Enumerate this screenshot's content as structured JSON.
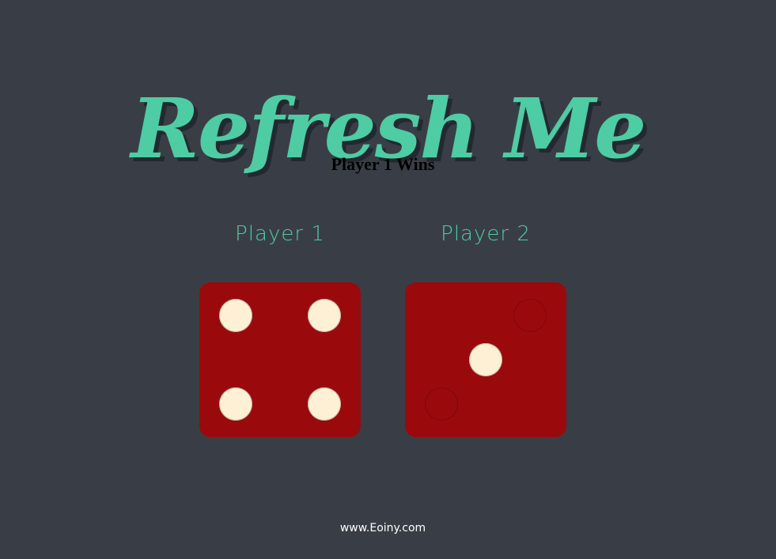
{
  "header": {
    "title": "Refresh Me"
  },
  "game": {
    "result": "Player 1 Wins",
    "players": [
      {
        "label": "Player 1",
        "die_value": 4
      },
      {
        "label": "Player 2",
        "die_value": 1
      }
    ],
    "die_color": "#9a0a0d",
    "pip_color": "#fdf0d5"
  },
  "theme": {
    "background": "#393e46",
    "accent": "#4ecca3"
  },
  "footer": {
    "text": "www.Eoiny.com"
  }
}
